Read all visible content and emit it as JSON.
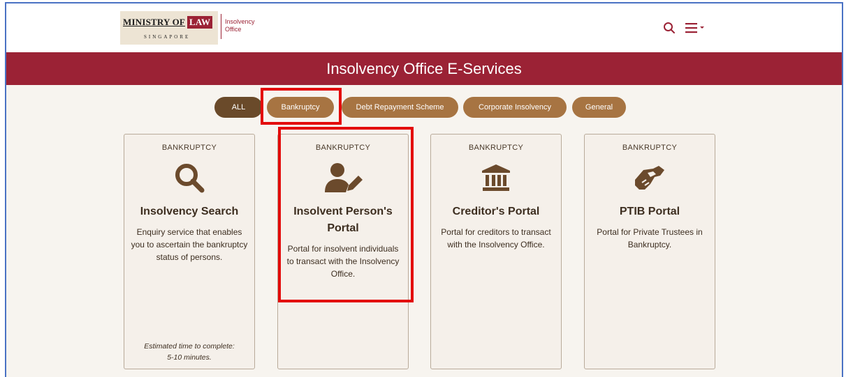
{
  "header": {
    "logo": {
      "ministry": "MINISTRY OF",
      "law": "LAW",
      "country": "SINGAPORE",
      "sub_line1": "Insolvency",
      "sub_line2": "Office"
    },
    "icons": [
      "search-icon",
      "menu-icon"
    ]
  },
  "banner": {
    "title": "Insolvency Office E-Services"
  },
  "filters": [
    {
      "label": "ALL",
      "active": true
    },
    {
      "label": "Bankruptcy",
      "active": false,
      "highlighted": true
    },
    {
      "label": "Debt Repayment Scheme",
      "active": false
    },
    {
      "label": "Corporate Insolvency",
      "active": false
    },
    {
      "label": "General",
      "active": false
    }
  ],
  "cards": [
    {
      "category": "BANKRUPTCY",
      "icon": "search-icon",
      "title": "Insolvency Search",
      "description": "Enquiry service that enables you to ascertain the bankruptcy status of persons.",
      "footer_line1": "Estimated time to complete:",
      "footer_line2": "5-10 minutes."
    },
    {
      "category": "BANKRUPTCY",
      "icon": "user-edit-icon",
      "title": "Insolvent Person's Portal",
      "description": "Portal for insolvent individuals to transact with the Insolvency Office.",
      "highlighted": true
    },
    {
      "category": "BANKRUPTCY",
      "icon": "bank-icon",
      "title": "Creditor's Portal",
      "description": "Portal for creditors to transact with the Insolvency Office."
    },
    {
      "category": "BANKRUPTCY",
      "icon": "handshake-icon",
      "title": "PTIB Portal",
      "description": "Portal for Private Trustees in Bankruptcy."
    }
  ],
  "colors": {
    "brand": "#9b2235",
    "pill": "#a77442",
    "pill_active": "#6a4a2a",
    "icon": "#6b4a2c",
    "highlight": "#e30a0a"
  }
}
